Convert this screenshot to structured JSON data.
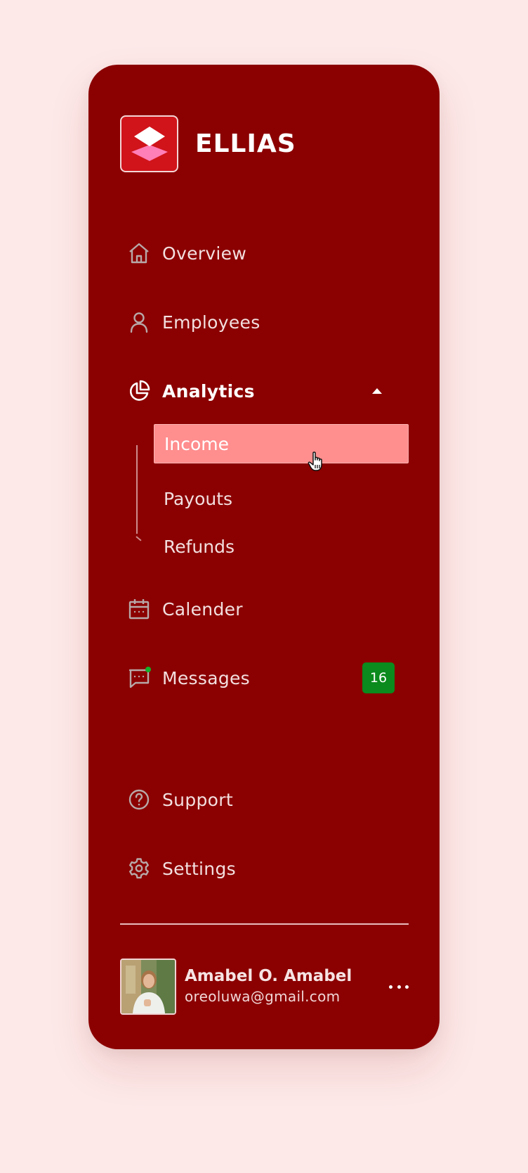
{
  "brand": {
    "name": "ELLIAS",
    "logo_icon": "layers-icon",
    "logo_colors": {
      "bg": "#d0141a",
      "top": "#ffffff",
      "bottom": "#ff7fb8"
    }
  },
  "nav": {
    "overview": {
      "label": "Overview",
      "icon": "home-icon"
    },
    "employees": {
      "label": "Employees",
      "icon": "user-icon"
    },
    "analytics": {
      "label": "Analytics",
      "icon": "pie-chart-icon",
      "expanded": true,
      "children": [
        {
          "label": "Income",
          "selected": true
        },
        {
          "label": "Payouts",
          "selected": false
        },
        {
          "label": "Refunds",
          "selected": false
        }
      ]
    },
    "calender": {
      "label": "Calender",
      "icon": "calendar-icon"
    },
    "messages": {
      "label": "Messages",
      "icon": "message-icon",
      "badge": "16"
    },
    "support": {
      "label": "Support",
      "icon": "help-circle-icon"
    },
    "settings": {
      "label": "Settings",
      "icon": "gear-icon"
    }
  },
  "profile": {
    "name": "Amabel O. Amabel",
    "email": "oreoluwa@gmail.com",
    "menu_icon": "more-horizontal-icon"
  },
  "colors": {
    "page_bg": "#fde9e8",
    "sidebar_bg": "#8b0000",
    "selected_bg": "#ff8e8e",
    "badge_bg": "#0b8a1d"
  }
}
